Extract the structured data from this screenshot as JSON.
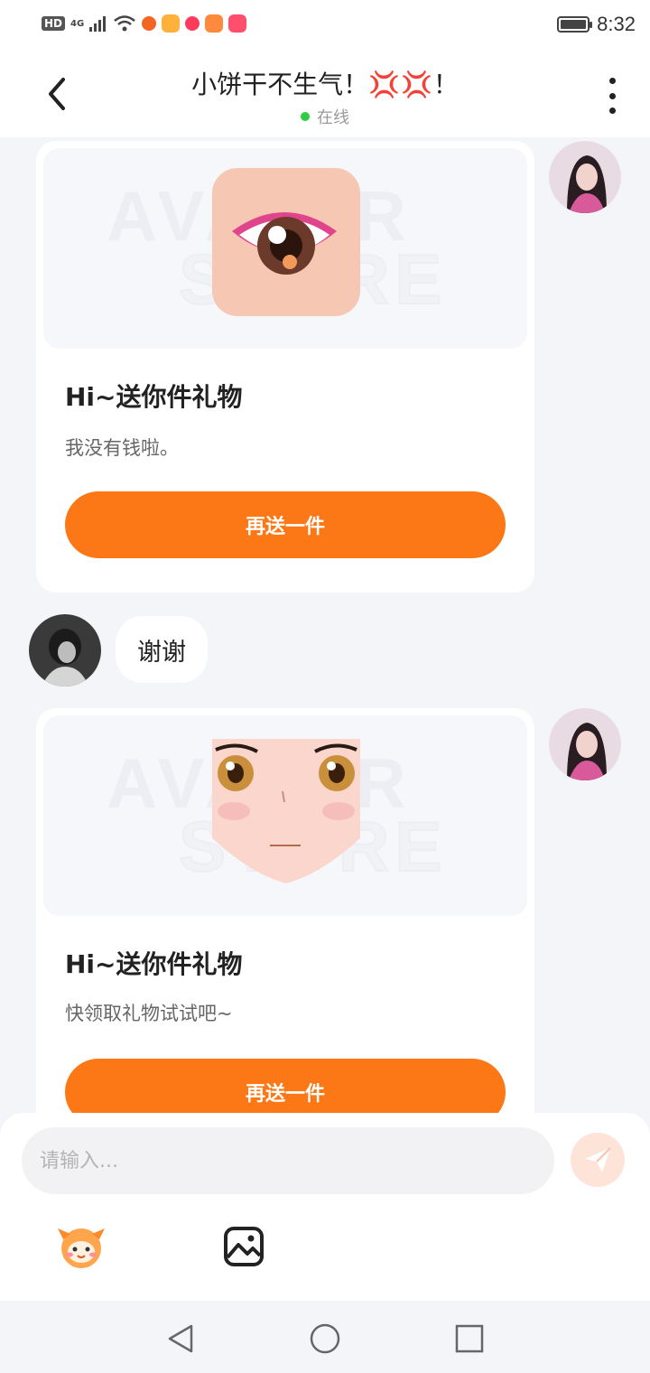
{
  "status_bar": {
    "network_badge": "HD",
    "network_type": "4G",
    "time": "8:32",
    "app_icons": [
      "weibo-icon",
      "video-app-icon",
      "music-app-icon",
      "player-app-icon",
      "shop-app-icon"
    ],
    "app_icon_colors": [
      "#f26522",
      "#ffb13b",
      "#ff3b5c",
      "#ff8a3d",
      "#ff4f6d"
    ]
  },
  "header": {
    "title": "小饼干不生气！",
    "title_emoji": "💢💢",
    "title_suffix": "！",
    "status": "在线",
    "status_color": "#2ecc40"
  },
  "messages": [
    {
      "type": "gift",
      "side": "right",
      "title": "Hi~送你件礼物",
      "desc": "我没有钱啦。",
      "button": "再送一件",
      "watermark": [
        "AVATAR",
        "STORE"
      ]
    },
    {
      "type": "text",
      "side": "left",
      "text": "谢谢"
    },
    {
      "type": "gift",
      "side": "right",
      "title": "Hi~送你件礼物",
      "desc": "快领取礼物试试吧~",
      "button": "再送一件",
      "watermark": [
        "AVATAR",
        "STORE"
      ]
    }
  ],
  "input": {
    "placeholder": "请输入..."
  },
  "colors": {
    "accent": "#fc7715",
    "background": "#f4f5f9",
    "send_button": "#fde3d8"
  }
}
